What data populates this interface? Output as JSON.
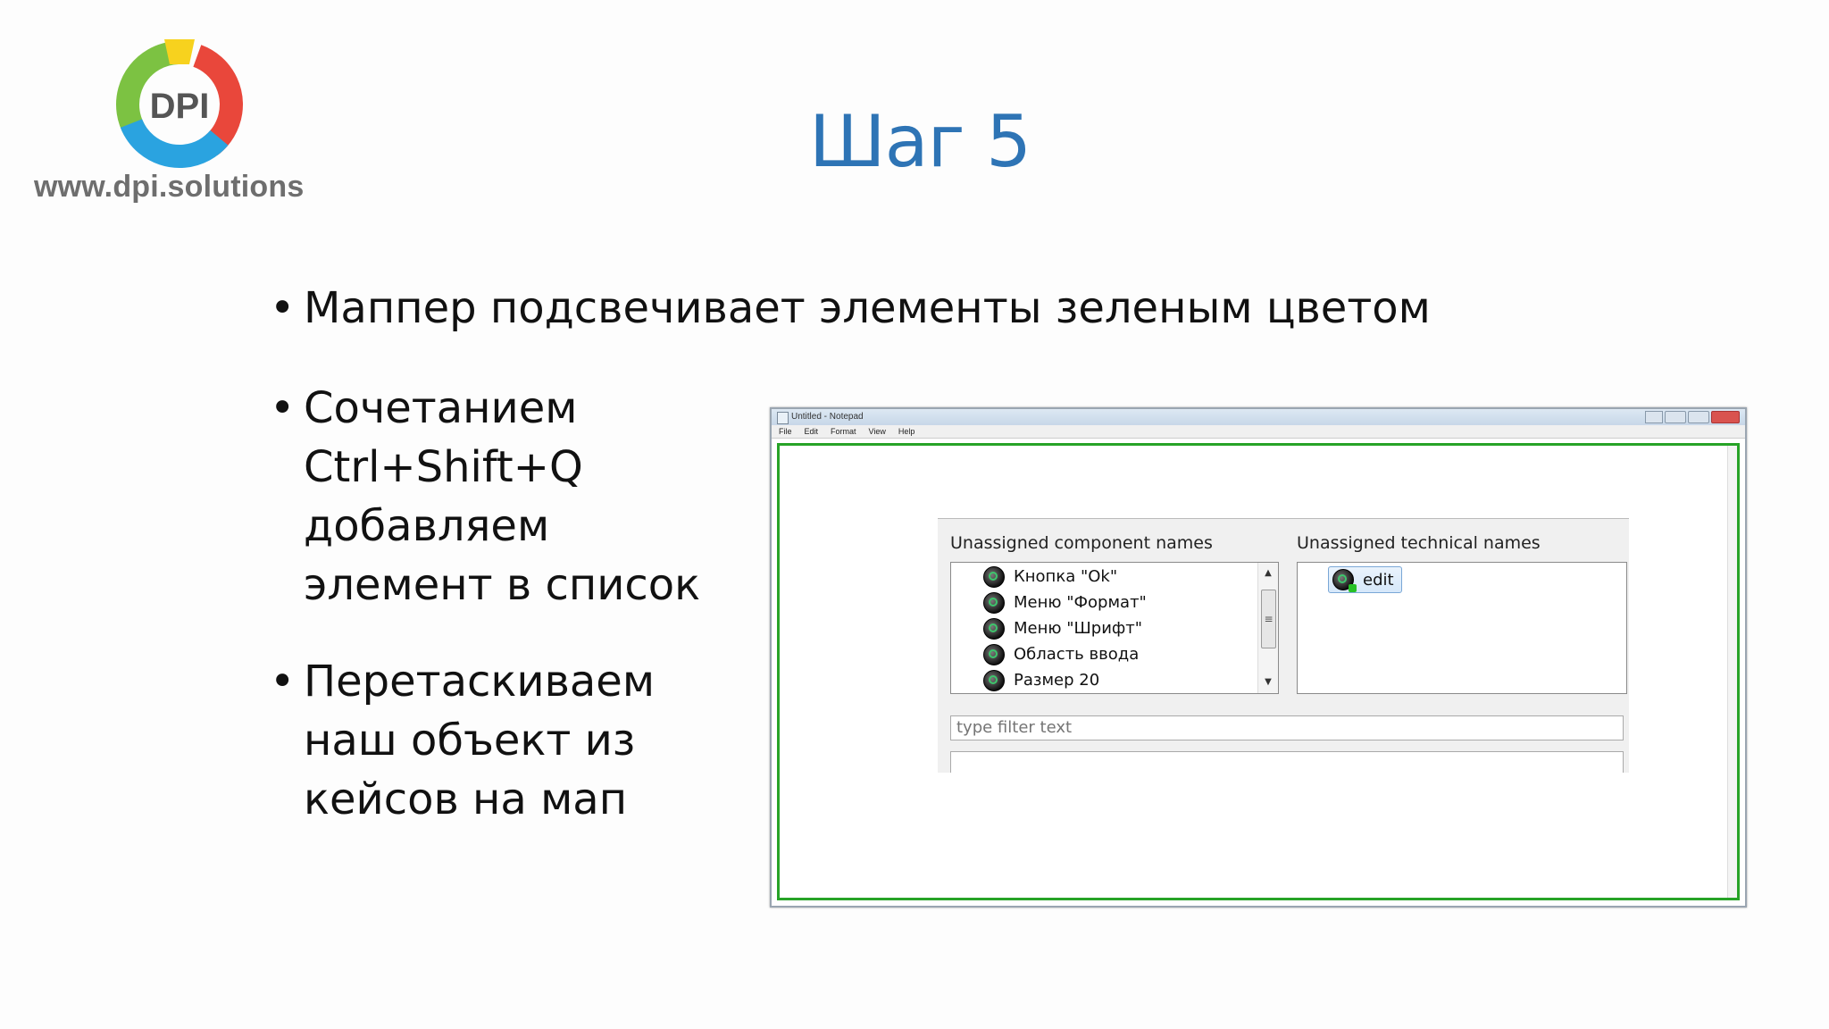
{
  "logo": {
    "text": "DPI",
    "url": "www.dpi.solutions"
  },
  "title": "Шаг 5",
  "bullets": [
    {
      "bullet": "•",
      "text": "Маппер подсвечивает элементы зеленым цветом"
    },
    {
      "bullet": "•",
      "text": "Сочетанием\nCtrl+Shift+Q\nдобавляем\nэлемент в список"
    },
    {
      "bullet": "•",
      "text": "Перетаскиваем\nнаш объект из\nкейсов на мап"
    }
  ],
  "notepad": {
    "window_title": "Untitled - Notepad",
    "menu": [
      "File",
      "Edit",
      "Format",
      "View",
      "Help"
    ],
    "highlight_color": "#27a327"
  },
  "mapper": {
    "left_label": "Unassigned component names",
    "right_label": "Unassigned technical names",
    "components": [
      "Кнопка \"Ok\"",
      "Меню \"Формат\"",
      "Меню \"Шрифт\"",
      "Область ввода",
      "Размер 20"
    ],
    "technical": [
      "edit"
    ],
    "filter_placeholder": "type filter text"
  }
}
